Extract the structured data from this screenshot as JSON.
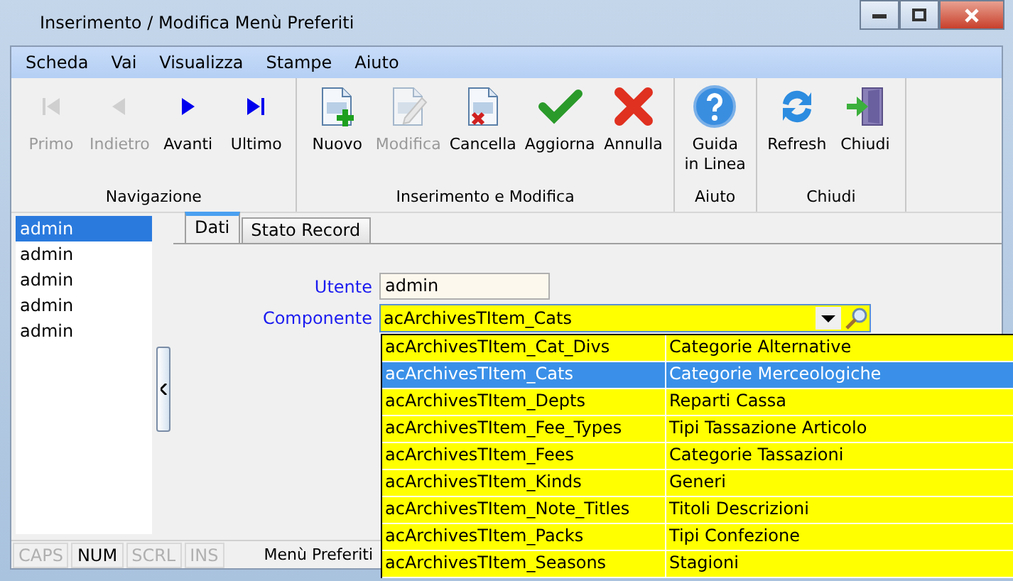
{
  "window": {
    "title": "Inserimento / Modifica Menù Preferiti"
  },
  "menu": [
    {
      "label": "Scheda"
    },
    {
      "label": "Vai"
    },
    {
      "label": "Visualizza"
    },
    {
      "label": "Stampe"
    },
    {
      "label": "Aiuto"
    }
  ],
  "toolbar": {
    "groups": [
      {
        "label": "Navigazione",
        "buttons": [
          {
            "label": "Primo",
            "kind": "first",
            "disabled": true
          },
          {
            "label": "Indietro",
            "kind": "prev",
            "disabled": true
          },
          {
            "label": "Avanti",
            "kind": "next",
            "disabled": false
          },
          {
            "label": "Ultimo",
            "kind": "last",
            "disabled": false
          }
        ]
      },
      {
        "label": "Inserimento e Modifica",
        "buttons": [
          {
            "label": "Nuovo",
            "kind": "new",
            "disabled": false
          },
          {
            "label": "Modifica",
            "kind": "edit",
            "disabled": true
          },
          {
            "label": "Cancella",
            "kind": "delete",
            "disabled": false
          },
          {
            "label": "Aggiorna",
            "kind": "ok",
            "disabled": false
          },
          {
            "label": "Annulla",
            "kind": "cancel",
            "disabled": false
          }
        ]
      },
      {
        "label": "Aiuto",
        "buttons": [
          {
            "label": "Guida\nin Linea",
            "kind": "help",
            "disabled": false
          }
        ]
      },
      {
        "label": "Chiudi",
        "buttons": [
          {
            "label": "Refresh",
            "kind": "refresh",
            "disabled": false
          },
          {
            "label": "Chiudi",
            "kind": "exit",
            "disabled": false
          }
        ]
      }
    ]
  },
  "record_list": {
    "items": [
      {
        "label": "admin",
        "selected": true
      },
      {
        "label": "admin",
        "selected": false
      },
      {
        "label": "admin",
        "selected": false
      },
      {
        "label": "admin",
        "selected": false
      },
      {
        "label": "admin",
        "selected": false
      }
    ]
  },
  "tabs": [
    {
      "label": "Dati",
      "selected": true
    },
    {
      "label": "Stato Record",
      "selected": false
    }
  ],
  "form": {
    "fields": [
      {
        "label": "Utente",
        "value": "admin",
        "kind": "text"
      },
      {
        "label": "Componente",
        "value": "acArchivesTItem_Cats",
        "kind": "combo"
      }
    ]
  },
  "dropdown": {
    "rows": [
      {
        "column_1": "acArchivesTItem_Cat_Divs",
        "column_2": "Categorie Alternative",
        "selected": false
      },
      {
        "column_1": "acArchivesTItem_Cats",
        "column_2": "Categorie Merceologiche",
        "selected": true
      },
      {
        "column_1": "acArchivesTItem_Depts",
        "column_2": "Reparti Cassa",
        "selected": false
      },
      {
        "column_1": "acArchivesTItem_Fee_Types",
        "column_2": "Tipi Tassazione Articolo",
        "selected": false
      },
      {
        "column_1": "acArchivesTItem_Fees",
        "column_2": "Categorie Tassazioni",
        "selected": false
      },
      {
        "column_1": "acArchivesTItem_Kinds",
        "column_2": "Generi",
        "selected": false
      },
      {
        "column_1": "acArchivesTItem_Note_Titles",
        "column_2": "Titoli Descrizioni",
        "selected": false
      },
      {
        "column_1": "acArchivesTItem_Packs",
        "column_2": "Tipi Confezione",
        "selected": false
      },
      {
        "column_1": "acArchivesTItem_Seasons",
        "column_2": "Stagioni",
        "selected": false
      }
    ]
  },
  "status_bar": {
    "indicators": [
      {
        "label": "CAPS",
        "on": false
      },
      {
        "label": "NUM",
        "on": true
      },
      {
        "label": "SCRL",
        "on": false
      },
      {
        "label": "INS",
        "on": false
      }
    ],
    "text": "Menù Preferiti"
  }
}
